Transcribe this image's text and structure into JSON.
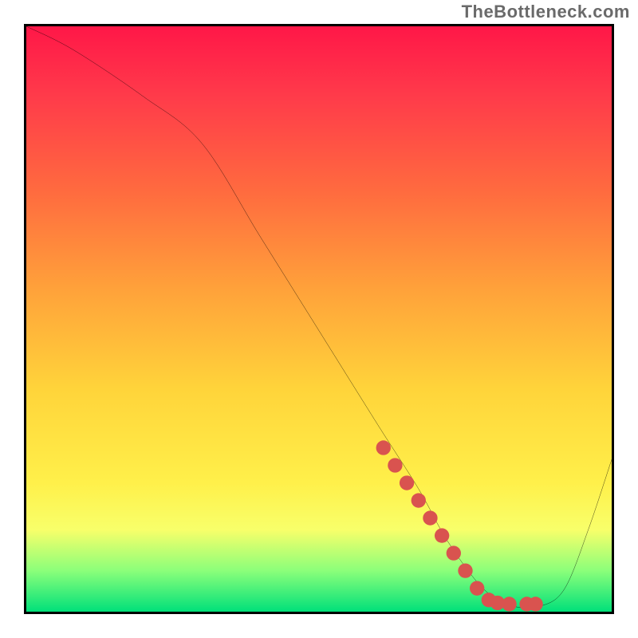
{
  "watermark": {
    "text": "TheBottleneck.com"
  },
  "chart_data": {
    "type": "line",
    "title": "",
    "xlabel": "",
    "ylabel": "",
    "xlim": [
      0,
      100
    ],
    "ylim": [
      0,
      100
    ],
    "grid": false,
    "legend": false,
    "series": [
      {
        "name": "bottleneck-curve",
        "color": "#000000",
        "x": [
          0,
          8,
          20,
          30,
          40,
          50,
          60,
          67,
          72,
          78,
          83,
          88,
          92,
          96,
          100
        ],
        "y": [
          100,
          96,
          88,
          80,
          64,
          48,
          32,
          21,
          12,
          4,
          1,
          1,
          4,
          14,
          26
        ]
      },
      {
        "name": "highlight-segment",
        "color": "#d9534f",
        "x": [
          61,
          63,
          65,
          67,
          69,
          71,
          73,
          75,
          77,
          79,
          80.5,
          82.5,
          85.5,
          87
        ],
        "y": [
          28,
          25,
          22,
          19,
          16,
          13,
          10,
          7,
          4,
          2,
          1.5,
          1.3,
          1.3,
          1.3
        ]
      }
    ],
    "background_gradient": {
      "direction": "vertical",
      "stops": [
        {
          "pos": 0.0,
          "color": "#ff1748"
        },
        {
          "pos": 0.12,
          "color": "#ff3b4a"
        },
        {
          "pos": 0.28,
          "color": "#ff6a3f"
        },
        {
          "pos": 0.45,
          "color": "#ffa23a"
        },
        {
          "pos": 0.62,
          "color": "#ffd43a"
        },
        {
          "pos": 0.78,
          "color": "#fff04a"
        },
        {
          "pos": 0.86,
          "color": "#f8ff6a"
        },
        {
          "pos": 0.93,
          "color": "#8bff7a"
        },
        {
          "pos": 1.0,
          "color": "#00e07a"
        }
      ]
    }
  }
}
